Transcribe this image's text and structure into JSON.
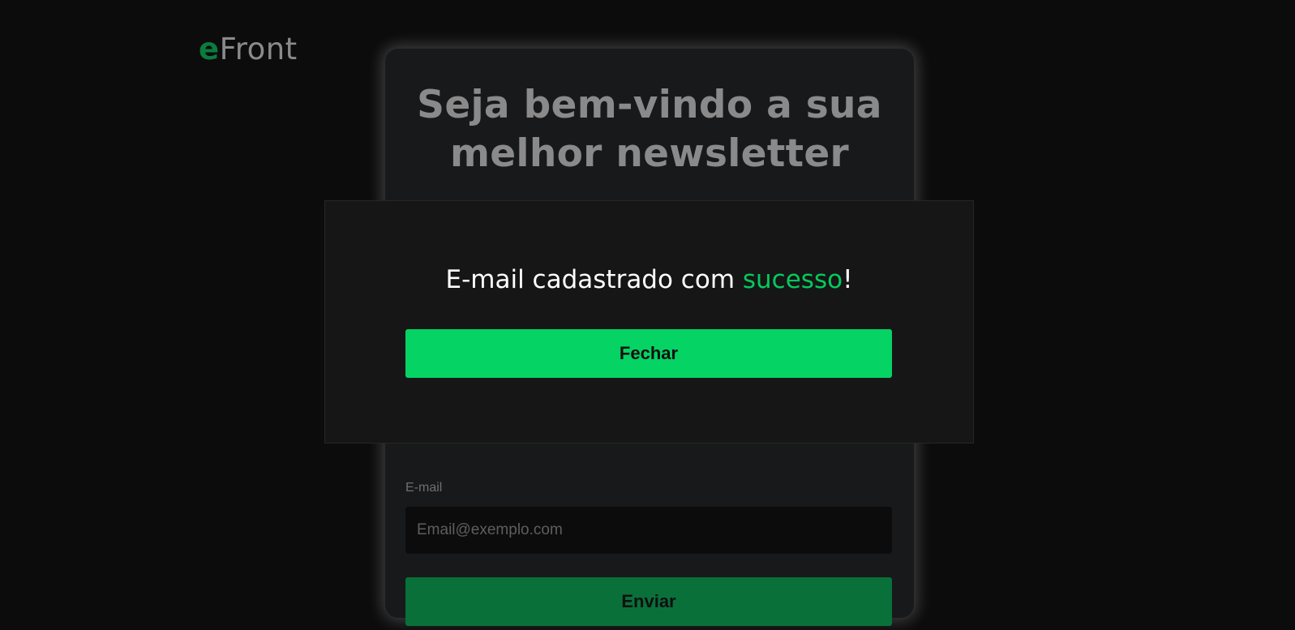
{
  "logo": {
    "accent_letter": "e",
    "rest": "Front",
    "accent_color": "#0a7c3e"
  },
  "card": {
    "title_line1": "Seja bem-vindo a sua",
    "title_line2": "melhor newsletter",
    "email_label": "E-mail",
    "email_placeholder": "Email@exemplo.com",
    "email_value": "",
    "send_label": "Enviar"
  },
  "modal": {
    "message_prefix": "E-mail cadastrado com ",
    "message_highlight": "sucesso",
    "message_suffix": "!",
    "highlight_color": "#05c95c",
    "close_label": "Fechar",
    "close_color": "#05d364"
  },
  "colors": {
    "background": "#0c0c0c",
    "card_background": "#18191b",
    "send_button": "#09703a"
  }
}
